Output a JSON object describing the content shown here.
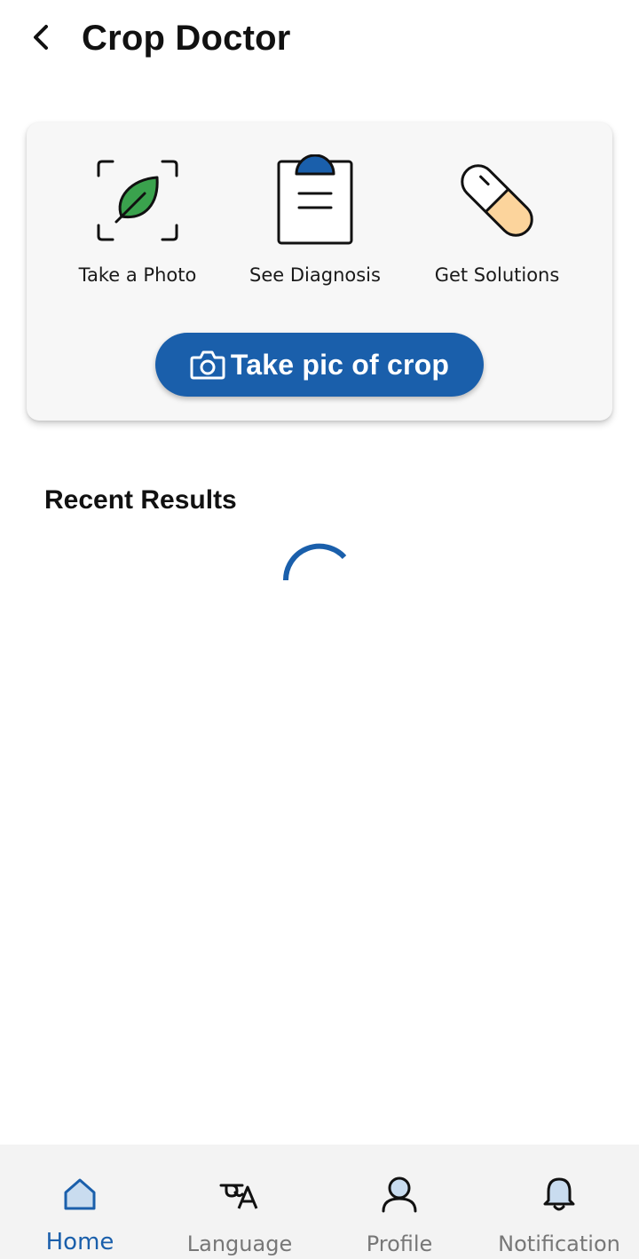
{
  "header": {
    "title": "Crop Doctor",
    "back_icon": "chevron-left-icon"
  },
  "steps_card": {
    "steps": [
      {
        "label": "Take a Photo",
        "icon": "leaf-scan-icon"
      },
      {
        "label": "See Diagnosis",
        "icon": "clipboard-icon"
      },
      {
        "label": "Get Solutions",
        "icon": "pill-icon"
      }
    ],
    "cta": {
      "label": "Take pic of crop",
      "icon": "camera-icon"
    }
  },
  "recent": {
    "title": "Recent Results",
    "loading_icon": "loading-spinner-icon"
  },
  "bottom_nav": {
    "items": [
      {
        "label": "Home",
        "icon": "home-icon",
        "active": true
      },
      {
        "label": "Language",
        "icon": "translate-icon",
        "active": false
      },
      {
        "label": "Profile",
        "icon": "user-icon",
        "active": false
      },
      {
        "label": "Notification",
        "icon": "bell-icon",
        "active": false
      }
    ]
  },
  "colors": {
    "primary": "#1a5fab",
    "leaf_green": "#3aa24d",
    "pill_orange": "#fcd49c",
    "card_background": "#f7f7f7",
    "nav_background": "#f3f3f3",
    "inactive_nav": "#777777"
  }
}
